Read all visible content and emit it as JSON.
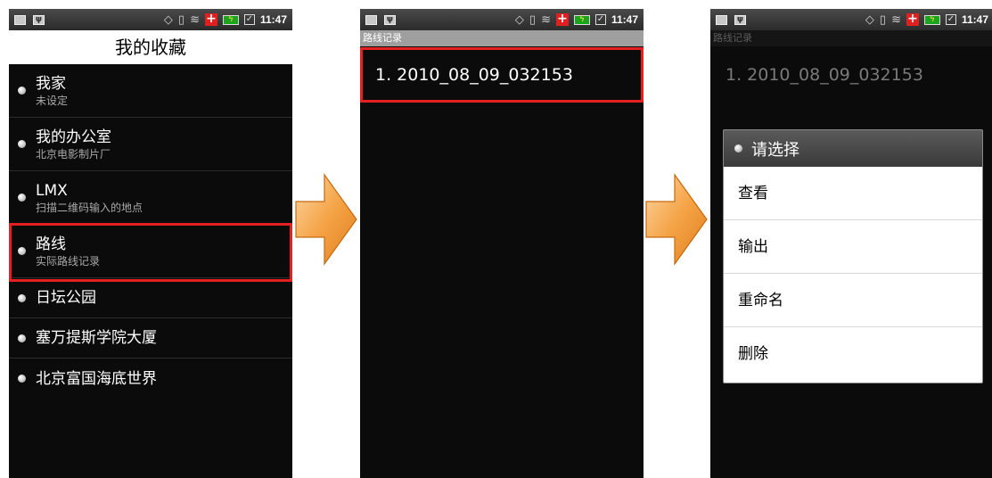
{
  "status_bar": {
    "time": "11:47"
  },
  "screen1": {
    "title": "我的收藏",
    "items": [
      {
        "title": "我家",
        "subtitle": "未设定"
      },
      {
        "title": "我的办公室",
        "subtitle": "北京电影制片厂"
      },
      {
        "title": "LMX",
        "subtitle": "扫描二维码输入的地点"
      },
      {
        "title": "路线",
        "subtitle": "实际路线记录"
      },
      {
        "title": "日坛公园"
      },
      {
        "title": "塞万提斯学院大厦"
      },
      {
        "title": "北京富国海底世界"
      }
    ]
  },
  "screen2": {
    "title": "路线记录",
    "records": [
      "1. 2010_08_09_032153"
    ]
  },
  "screen3": {
    "title": "路线记录",
    "records": [
      "1. 2010_08_09_032153"
    ],
    "dialog": {
      "title": "请选择",
      "options": [
        "查看",
        "输出",
        "重命名",
        "删除"
      ]
    }
  },
  "colors": {
    "highlight": "#e52020",
    "arrow": "#f19a3e",
    "screen_bg": "#0b0b0b"
  },
  "icons": [
    "mail-icon",
    "usb-icon",
    "gps-icon",
    "vibrate-icon",
    "wifi-icon",
    "medical-icon",
    "battery-icon",
    "checkbox-icon",
    "arrow-right-icon"
  ]
}
